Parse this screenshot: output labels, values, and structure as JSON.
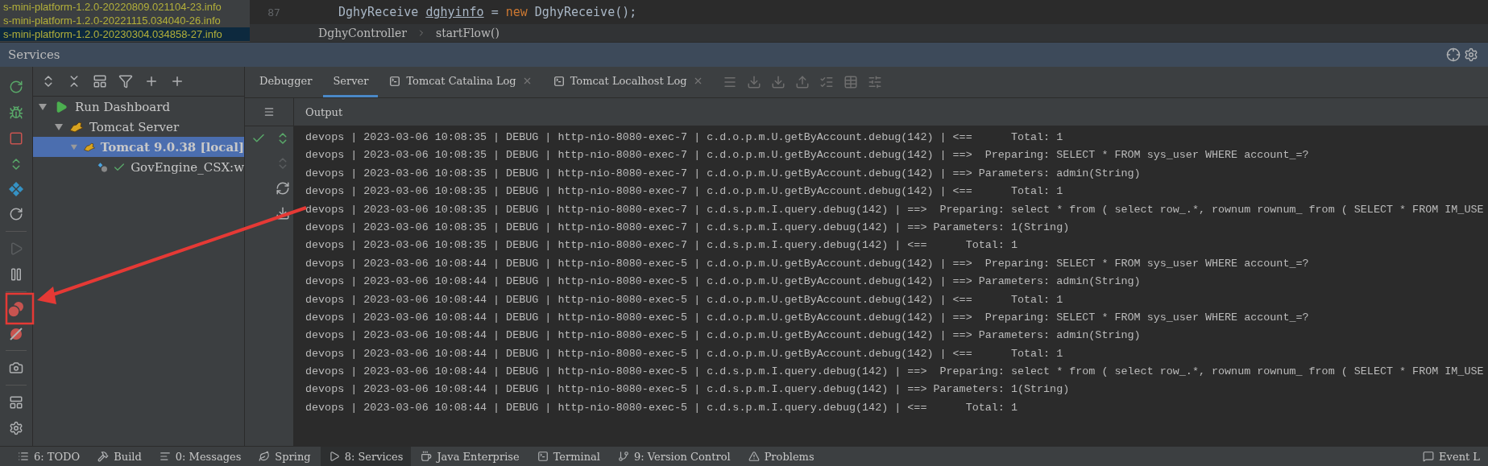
{
  "project_files": [
    {
      "name": "s-mini-platform-1.2.0-20220809.021104-23.info",
      "selected": false
    },
    {
      "name": "s-mini-platform-1.2.0-20221115.034040-26.info",
      "selected": false
    },
    {
      "name": "s-mini-platform-1.2.0-20230304.034858-27.info",
      "selected": true
    }
  ],
  "editor": {
    "line_number": "87",
    "tokens": [
      {
        "kind": "plain",
        "text": "DghyReceive "
      },
      {
        "kind": "var",
        "text": "dghyinfo"
      },
      {
        "kind": "plain",
        "text": " = "
      },
      {
        "kind": "keyword",
        "text": "new"
      },
      {
        "kind": "plain",
        "text": " DghyReceive();"
      }
    ],
    "breadcrumbs": [
      "DghyController",
      "startFlow()"
    ]
  },
  "panel": {
    "title": "Services"
  },
  "tree": [
    {
      "label": "Run Dashboard",
      "kind": "dashboard",
      "expanded": true,
      "selected": false,
      "children": [
        {
          "label": "Tomcat Server",
          "kind": "server",
          "expanded": true,
          "selected": false,
          "children": [
            {
              "label": "Tomcat 9.0.38 [local]",
              "kind": "instance",
              "expanded": true,
              "selected": true,
              "children": [
                {
                  "label": "GovEngine_CSX:w",
                  "kind": "artifact",
                  "selected": false
                }
              ]
            }
          ]
        }
      ]
    }
  ],
  "tabs": [
    {
      "label": "Debugger",
      "kind": "plain",
      "selected": false
    },
    {
      "label": "Server",
      "kind": "plain",
      "selected": true
    },
    {
      "label": "Tomcat Catalina Log",
      "kind": "log",
      "selected": false
    },
    {
      "label": "Tomcat Localhost Log",
      "kind": "log",
      "selected": false
    }
  ],
  "output": {
    "title": "Output",
    "lines": [
      "devops | 2023-03-06 10:08:35 | DEBUG | http-nio-8080-exec-7 | c.d.o.p.m.U.getByAccount.debug(142) | <==      Total: 1",
      "devops | 2023-03-06 10:08:35 | DEBUG | http-nio-8080-exec-7 | c.d.o.p.m.U.getByAccount.debug(142) | ==>  Preparing: SELECT * FROM sys_user WHERE account_=?",
      "devops | 2023-03-06 10:08:35 | DEBUG | http-nio-8080-exec-7 | c.d.o.p.m.U.getByAccount.debug(142) | ==> Parameters: admin(String)",
      "devops | 2023-03-06 10:08:35 | DEBUG | http-nio-8080-exec-7 | c.d.o.p.m.U.getByAccount.debug(142) | <==      Total: 1",
      "devops | 2023-03-06 10:08:35 | DEBUG | http-nio-8080-exec-7 | c.d.s.p.m.I.query.debug(142) | ==>  Preparing: select * from ( select row_.*, rownum rownum_ from ( SELECT * FROM IM_USE",
      "devops | 2023-03-06 10:08:35 | DEBUG | http-nio-8080-exec-7 | c.d.s.p.m.I.query.debug(142) | ==> Parameters: 1(String)",
      "devops | 2023-03-06 10:08:35 | DEBUG | http-nio-8080-exec-7 | c.d.s.p.m.I.query.debug(142) | <==      Total: 1",
      "devops | 2023-03-06 10:08:44 | DEBUG | http-nio-8080-exec-5 | c.d.o.p.m.U.getByAccount.debug(142) | ==>  Preparing: SELECT * FROM sys_user WHERE account_=?",
      "devops | 2023-03-06 10:08:44 | DEBUG | http-nio-8080-exec-5 | c.d.o.p.m.U.getByAccount.debug(142) | ==> Parameters: admin(String)",
      "devops | 2023-03-06 10:08:44 | DEBUG | http-nio-8080-exec-5 | c.d.o.p.m.U.getByAccount.debug(142) | <==      Total: 1",
      "devops | 2023-03-06 10:08:44 | DEBUG | http-nio-8080-exec-5 | c.d.o.p.m.U.getByAccount.debug(142) | ==>  Preparing: SELECT * FROM sys_user WHERE account_=?",
      "devops | 2023-03-06 10:08:44 | DEBUG | http-nio-8080-exec-5 | c.d.o.p.m.U.getByAccount.debug(142) | ==> Parameters: admin(String)",
      "devops | 2023-03-06 10:08:44 | DEBUG | http-nio-8080-exec-5 | c.d.o.p.m.U.getByAccount.debug(142) | <==      Total: 1",
      "devops | 2023-03-06 10:08:44 | DEBUG | http-nio-8080-exec-5 | c.d.s.p.m.I.query.debug(142) | ==>  Preparing: select * from ( select row_.*, rownum rownum_ from ( SELECT * FROM IM_USE",
      "devops | 2023-03-06 10:08:44 | DEBUG | http-nio-8080-exec-5 | c.d.s.p.m.I.query.debug(142) | ==> Parameters: 1(String)",
      "devops | 2023-03-06 10:08:44 | DEBUG | http-nio-8080-exec-5 | c.d.s.p.m.I.query.debug(142) | <==      Total: 1"
    ]
  },
  "bottom_tabs": [
    {
      "label": "6: TODO",
      "kind": "todo",
      "selected": false
    },
    {
      "label": "Build",
      "kind": "build",
      "selected": false
    },
    {
      "label": "0: Messages",
      "kind": "messages",
      "selected": false
    },
    {
      "label": "Spring",
      "kind": "spring",
      "selected": false
    },
    {
      "label": "8: Services",
      "kind": "services",
      "selected": true
    },
    {
      "label": "Java Enterprise",
      "kind": "enterprise",
      "selected": false
    },
    {
      "label": "Terminal",
      "kind": "terminal",
      "selected": false
    },
    {
      "label": "9: Version Control",
      "kind": "vcs",
      "selected": false
    },
    {
      "label": "Problems",
      "kind": "problems",
      "selected": false
    }
  ],
  "event_log": {
    "label": "Event L"
  }
}
